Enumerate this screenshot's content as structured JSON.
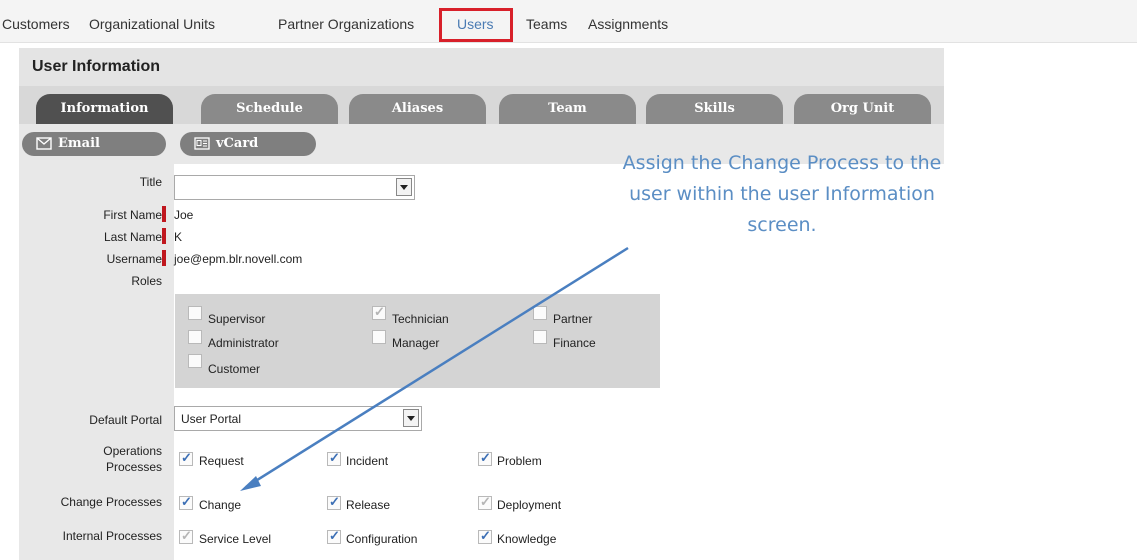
{
  "topnav": {
    "items": [
      "Customers",
      "Organizational Units",
      "Partner Organizations",
      "Users",
      "Teams",
      "Assignments"
    ],
    "active": "Users"
  },
  "panel": {
    "title": "User Information"
  },
  "tabs": [
    "Information",
    "Schedule",
    "Aliases",
    "Team",
    "Skills",
    "Org Unit"
  ],
  "active_tab": "Information",
  "actions": {
    "email_label": "Email",
    "vcard_label": "vCard"
  },
  "form": {
    "title_label": "Title",
    "title_value": "",
    "first_name_label": "First Name",
    "first_name": "Joe",
    "last_name_label": "Last Name",
    "last_name": "K",
    "username_label": "Username",
    "username": "joe@epm.blr.novell.com",
    "roles_label": "Roles",
    "roles": [
      {
        "label": "Supervisor",
        "state": "unchecked"
      },
      {
        "label": "Technician",
        "state": "checked-disabled"
      },
      {
        "label": "Partner",
        "state": "unchecked"
      },
      {
        "label": "Administrator",
        "state": "unchecked"
      },
      {
        "label": "Manager",
        "state": "unchecked"
      },
      {
        "label": "Finance",
        "state": "unchecked"
      },
      {
        "label": "Customer",
        "state": "unchecked"
      }
    ],
    "default_portal_label": "Default Portal",
    "default_portal_value": "User Portal",
    "operations_label_1": "Operations",
    "operations_label_2": "Processes",
    "operations": [
      {
        "label": "Request",
        "state": "checked"
      },
      {
        "label": "Incident",
        "state": "checked"
      },
      {
        "label": "Problem",
        "state": "checked"
      }
    ],
    "change_label": "Change Processes",
    "change": [
      {
        "label": "Change",
        "state": "checked"
      },
      {
        "label": "Release",
        "state": "checked"
      },
      {
        "label": "Deployment",
        "state": "checked-disabled"
      }
    ],
    "internal_label": "Internal Processes",
    "internal": [
      {
        "label": "Service Level",
        "state": "checked-disabled"
      },
      {
        "label": "Configuration",
        "state": "checked"
      },
      {
        "label": "Knowledge",
        "state": "checked"
      }
    ]
  },
  "annotation": {
    "line1": "Assign the Change Process to the",
    "line2": "user within the user Information",
    "line3": "screen."
  },
  "colors": {
    "highlight": "#d8202a",
    "annotation": "#5b8ec4",
    "required": "#c0171e",
    "check": "#3c6fb5"
  }
}
